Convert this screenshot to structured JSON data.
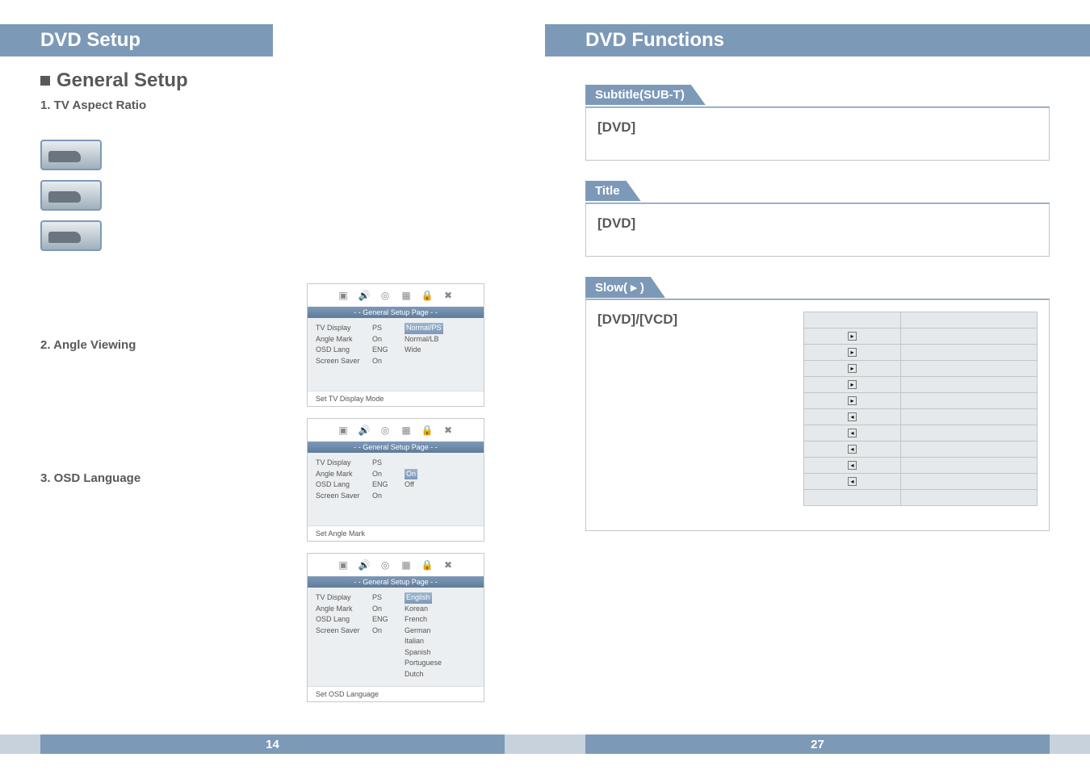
{
  "left": {
    "header": "DVD Setup",
    "section": "General Setup",
    "s1": {
      "title": "1. TV Aspect Ratio"
    },
    "s2": {
      "title": "2. Angle Viewing"
    },
    "s3": {
      "title": "3. OSD Language"
    },
    "osd1": {
      "banner": "- - General Setup Page - -",
      "rows": [
        [
          "TV Display",
          "PS",
          "Normal/PS"
        ],
        [
          "Angle Mark",
          "On",
          "Normal/LB"
        ],
        [
          "OSD Lang",
          "ENG",
          "Wide"
        ],
        [
          "Screen Saver",
          "On",
          ""
        ]
      ],
      "foot": "Set TV Display Mode"
    },
    "osd2": {
      "banner": "- - General Setup Page - -",
      "rows": [
        [
          "TV Display",
          "PS",
          ""
        ],
        [
          "Angle Mark",
          "On",
          "On"
        ],
        [
          "OSD Lang",
          "ENG",
          "Off"
        ],
        [
          "Screen Saver",
          "On",
          ""
        ]
      ],
      "foot": "Set Angle Mark"
    },
    "osd3": {
      "banner": "- - General Setup Page - -",
      "rows": [
        [
          "TV Display",
          "PS",
          "English"
        ],
        [
          "Angle Mark",
          "On",
          "Korean"
        ],
        [
          "OSD Lang",
          "ENG",
          "French"
        ],
        [
          "Screen Saver",
          "On",
          "German"
        ],
        [
          "",
          "",
          "Italian"
        ],
        [
          "",
          "",
          "Spanish"
        ],
        [
          "",
          "",
          "Portuguese"
        ],
        [
          "",
          "",
          "Dutch"
        ]
      ],
      "foot": "Set OSD Language"
    },
    "pagenum": "14"
  },
  "right": {
    "header": "DVD Functions",
    "sec1": {
      "tab": "Subtitle(SUB-T)",
      "label": "[DVD]"
    },
    "sec2": {
      "tab": "Title",
      "label": "[DVD]"
    },
    "sec3": {
      "tab": "Slow( ▸ )",
      "label": "[DVD]/[VCD]"
    },
    "slow_rows": [
      "▸",
      "▸",
      "▸",
      "▸",
      "▸",
      "◂",
      "◂",
      "◂",
      "◂",
      "◂",
      ""
    ],
    "pagenum": "27"
  }
}
